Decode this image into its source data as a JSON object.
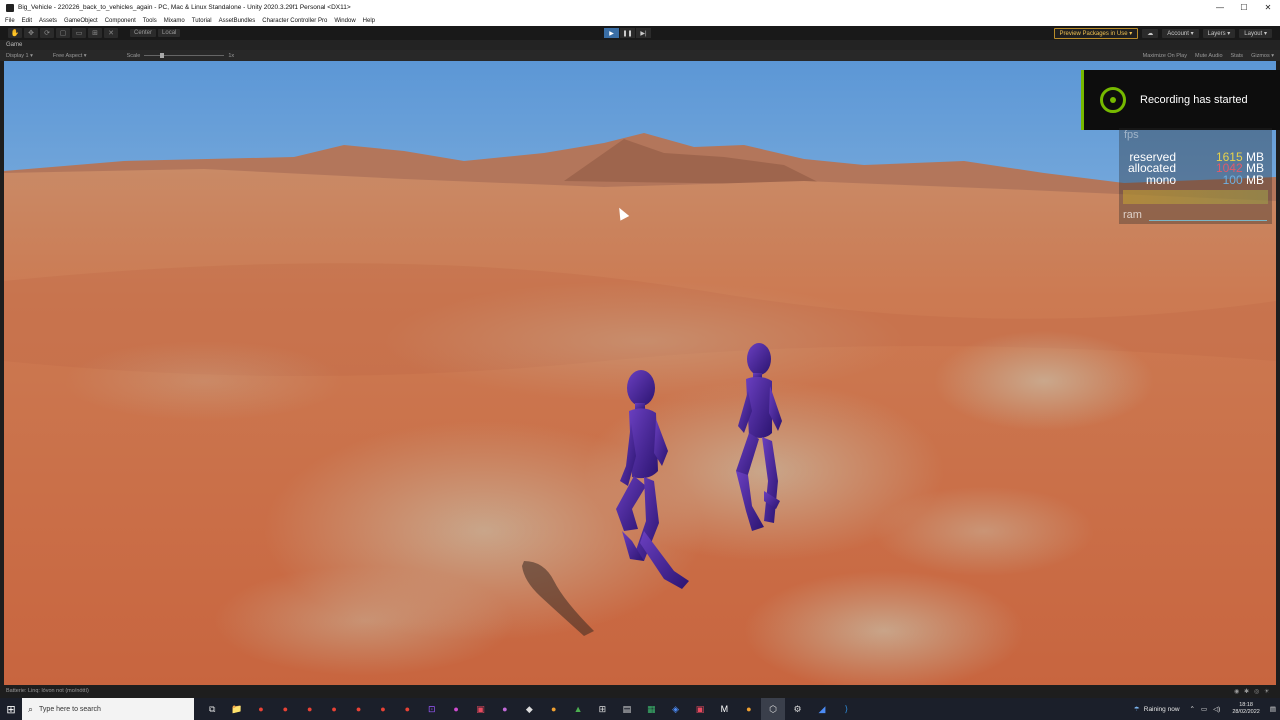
{
  "window": {
    "title": "Big_Vehicle - 220226_back_to_vehicles_again - PC, Mac & Linux Standalone - Unity 2020.3.29f1 Personal <DX11>",
    "minimize": "—",
    "maximize": "☐",
    "close": "✕"
  },
  "menu": [
    "File",
    "Edit",
    "Assets",
    "GameObject",
    "Component",
    "Tools",
    "Mixamo",
    "Tutorial",
    "AssetBundles",
    "Character Controller Pro",
    "Window",
    "Help"
  ],
  "toolbar": {
    "tools": [
      "✋",
      "✥",
      "⟳",
      "▢",
      "▭",
      "⊞",
      "✕"
    ],
    "pivot": "Center",
    "space": "Local",
    "play": "▶",
    "pause": "❚❚",
    "step": "▶|",
    "preview_packages": "Preview Packages in Use ▾",
    "cloud": "☁",
    "account": "Account ▾",
    "layers": "Layers ▾",
    "layout": "Layout ▾"
  },
  "game_tab": {
    "label": "Game",
    "display": "Display 1 ▾",
    "aspect": "Free Aspect ▾",
    "scale_label": "Scale",
    "scale_value": "1x",
    "maximize_on_play": "Maximize On Play",
    "mute_audio": "Mute Audio",
    "stats": "Stats",
    "gizmos": "Gizmos ▾"
  },
  "notification": {
    "text": "Recording has started",
    "accent": "#76b900"
  },
  "memory_stats": {
    "fps_label": "fps",
    "rows": [
      {
        "label": "reserved",
        "value": "1615",
        "unit": "MB",
        "color": "#e8d24a"
      },
      {
        "label": "allocated",
        "value": "1042",
        "unit": "MB",
        "color": "#e05a6a"
      },
      {
        "label": "mono",
        "value": "100",
        "unit": "MB",
        "color": "#6fb0e0"
      }
    ],
    "ram_label": "ram"
  },
  "status": {
    "message": "Batterie: Linq: lóvon not (mo/nóttí)"
  },
  "taskbar": {
    "start_icon": "⊞",
    "search_placeholder": "Type here to search",
    "search_icon": "⌕",
    "apps": [
      "⧉",
      "📁",
      "●",
      "●",
      "●",
      "●",
      "●",
      "●",
      "●",
      "⊡",
      "●",
      "▣",
      "●",
      "◆",
      "●",
      "▲",
      "⊞",
      "▤",
      "▦",
      "◈",
      "▣",
      "M",
      "●",
      "⬡",
      "⚙",
      "◢",
      "⟩"
    ],
    "weather": "Raining now",
    "time": "18:18",
    "date": "28/02/2022"
  }
}
